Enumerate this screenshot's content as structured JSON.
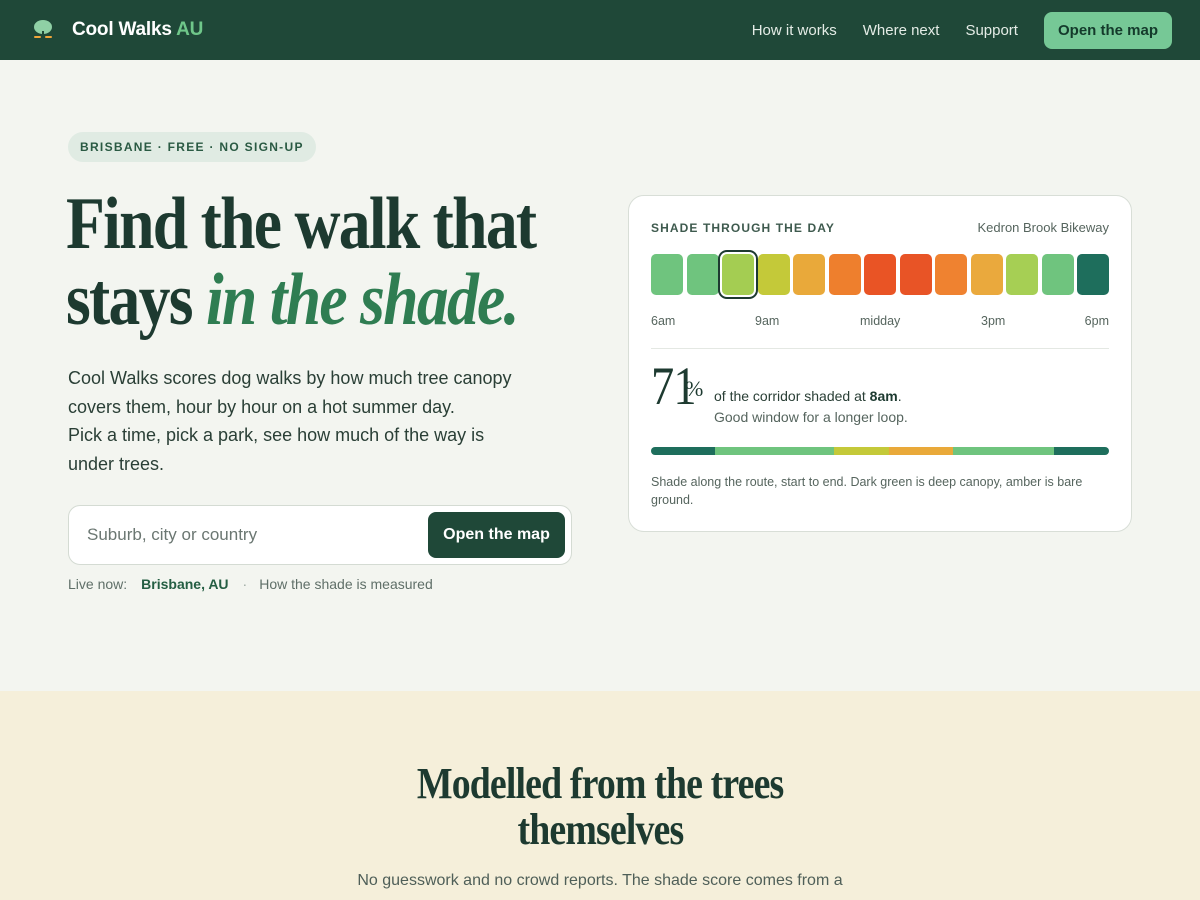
{
  "nav": {
    "brand_name": "Cool Walks",
    "brand_suffix": "AU",
    "links": [
      "How it works",
      "Where next",
      "Support"
    ],
    "cta_label": "Open the map"
  },
  "hero": {
    "pill": "BRISBANE · FREE · NO SIGN-UP",
    "headline_line1": "Find the walk that",
    "headline_line2_plain": "stays ",
    "headline_line2_em": "in the shade.",
    "lead_line1": "Cool Walks scores dog walks by how much tree canopy",
    "lead_line2": "covers them, hour by hour on a hot summer day.",
    "lead_line3": "Pick a time, pick a park, see how much of the way is",
    "lead_line4": "under trees.",
    "search_placeholder": "Suburb, city or country",
    "search_button": "Open the map",
    "live_label": "Live now:",
    "live_city": "Brisbane, AU",
    "live_separator": "·",
    "measure_link": "How the shade is measured"
  },
  "card": {
    "label": "SHADE THROUGH THE DAY",
    "route_name": "Kedron Brook Bikeway",
    "hours": [
      {
        "color": "#6fc47e"
      },
      {
        "color": "#6fc47e"
      },
      {
        "color": "#a4cd52",
        "selected": true
      },
      {
        "color": "#c4c939"
      },
      {
        "color": "#e9a93a"
      },
      {
        "color": "#ee7f2d"
      },
      {
        "color": "#e95425"
      },
      {
        "color": "#e85426"
      },
      {
        "color": "#ef8230"
      },
      {
        "color": "#eaa93d"
      },
      {
        "color": "#a6cf54"
      },
      {
        "color": "#6fc47e"
      },
      {
        "color": "#1e6e5c"
      }
    ],
    "tick_labels": [
      "6am",
      "9am",
      "midday",
      "3pm",
      "6pm"
    ],
    "shade_value": "71",
    "shade_unit": "%",
    "stat_text": "of the corridor shaded at ",
    "stat_time": "8am",
    "stat_end": ".",
    "stat_sub": "Good window for a longer loop.",
    "route_segments": [
      {
        "share": 0.14,
        "color": "#1e6e5c"
      },
      {
        "share": 0.26,
        "color": "#6fc47e"
      },
      {
        "share": 0.12,
        "color": "#c4c939"
      },
      {
        "share": 0.14,
        "color": "#e9a93a"
      },
      {
        "share": 0.22,
        "color": "#6fc47e"
      },
      {
        "share": 0.12,
        "color": "#1e6e5c"
      }
    ],
    "note": "Shade along the route, start to end. Dark green is deep canopy, amber is bare ground."
  },
  "section2": {
    "title_line1": "Modelled from the trees",
    "title_line2": "themselves",
    "body": "No guesswork and no crowd reports. The shade score comes from a"
  }
}
